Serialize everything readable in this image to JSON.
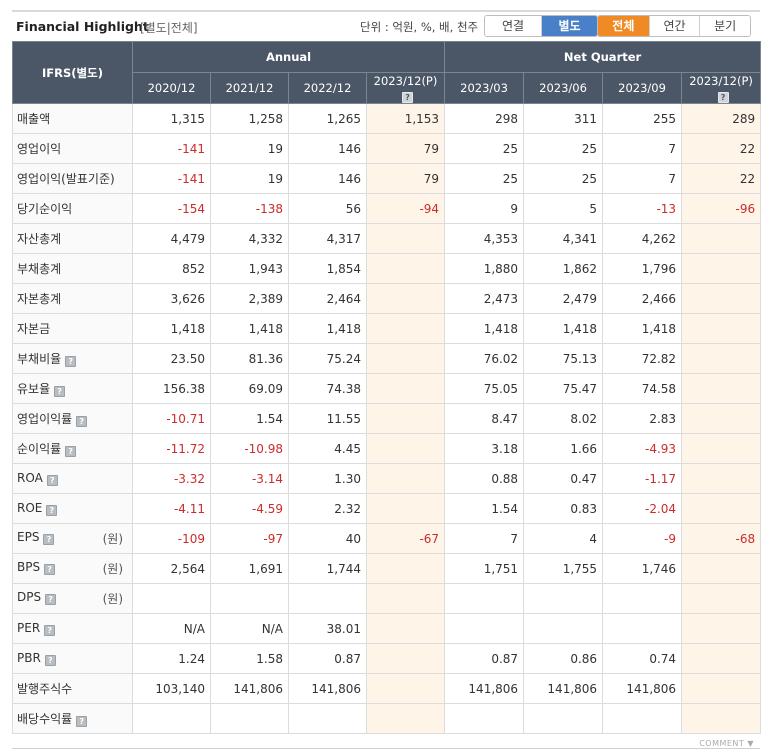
{
  "header": {
    "title": "Financial Highlight",
    "subtitle": "[별도|전체]",
    "unit_label": "단위 : 억원, %, 배, 천주",
    "toggle_basis": [
      "연결",
      "별도"
    ],
    "toggle_period": [
      "전체",
      "연간",
      "분기"
    ],
    "active_basis": "별도",
    "active_period": "전체"
  },
  "table": {
    "corner_label": "IFRS(별도)",
    "group_annual": "Annual",
    "group_quarter": "Net Quarter",
    "columns": [
      "2020/12",
      "2021/12",
      "2022/12",
      "2023/12(P)",
      "2023/03",
      "2023/06",
      "2023/09",
      "2023/12(P)"
    ],
    "rows": [
      {
        "label": "매출액",
        "unit": "",
        "help": false,
        "values": [
          "1,315",
          "1,258",
          "1,265",
          "1,153",
          "298",
          "311",
          "255",
          "289"
        ]
      },
      {
        "label": "영업이익",
        "unit": "",
        "help": false,
        "values": [
          "-141",
          "19",
          "146",
          "79",
          "25",
          "25",
          "7",
          "22"
        ]
      },
      {
        "label": "영업이익(발표기준)",
        "unit": "",
        "help": false,
        "values": [
          "-141",
          "19",
          "146",
          "79",
          "25",
          "25",
          "7",
          "22"
        ]
      },
      {
        "label": "당기순이익",
        "unit": "",
        "help": false,
        "values": [
          "-154",
          "-138",
          "56",
          "-94",
          "9",
          "5",
          "-13",
          "-96"
        ]
      },
      {
        "label": "자산총계",
        "unit": "",
        "help": false,
        "values": [
          "4,479",
          "4,332",
          "4,317",
          "",
          "4,353",
          "4,341",
          "4,262",
          ""
        ]
      },
      {
        "label": "부채총계",
        "unit": "",
        "help": false,
        "values": [
          "852",
          "1,943",
          "1,854",
          "",
          "1,880",
          "1,862",
          "1,796",
          ""
        ]
      },
      {
        "label": "자본총계",
        "unit": "",
        "help": false,
        "values": [
          "3,626",
          "2,389",
          "2,464",
          "",
          "2,473",
          "2,479",
          "2,466",
          ""
        ]
      },
      {
        "label": "자본금",
        "unit": "",
        "help": false,
        "values": [
          "1,418",
          "1,418",
          "1,418",
          "",
          "1,418",
          "1,418",
          "1,418",
          ""
        ]
      },
      {
        "label": "부채비율",
        "unit": "",
        "help": true,
        "values": [
          "23.50",
          "81.36",
          "75.24",
          "",
          "76.02",
          "75.13",
          "72.82",
          ""
        ]
      },
      {
        "label": "유보율",
        "unit": "",
        "help": true,
        "values": [
          "156.38",
          "69.09",
          "74.38",
          "",
          "75.05",
          "75.47",
          "74.58",
          ""
        ]
      },
      {
        "label": "영업이익률",
        "unit": "",
        "help": true,
        "values": [
          "-10.71",
          "1.54",
          "11.55",
          "",
          "8.47",
          "8.02",
          "2.83",
          ""
        ]
      },
      {
        "label": "순이익률",
        "unit": "",
        "help": true,
        "values": [
          "-11.72",
          "-10.98",
          "4.45",
          "",
          "3.18",
          "1.66",
          "-4.93",
          ""
        ]
      },
      {
        "label": "ROA",
        "unit": "",
        "help": true,
        "values": [
          "-3.32",
          "-3.14",
          "1.30",
          "",
          "0.88",
          "0.47",
          "-1.17",
          ""
        ]
      },
      {
        "label": "ROE",
        "unit": "",
        "help": true,
        "values": [
          "-4.11",
          "-4.59",
          "2.32",
          "",
          "1.54",
          "0.83",
          "-2.04",
          ""
        ]
      },
      {
        "label": "EPS",
        "unit": "(원)",
        "help": true,
        "values": [
          "-109",
          "-97",
          "40",
          "-67",
          "7",
          "4",
          "-9",
          "-68"
        ]
      },
      {
        "label": "BPS",
        "unit": "(원)",
        "help": true,
        "values": [
          "2,564",
          "1,691",
          "1,744",
          "",
          "1,751",
          "1,755",
          "1,746",
          ""
        ]
      },
      {
        "label": "DPS",
        "unit": "(원)",
        "help": true,
        "values": [
          "",
          "",
          "",
          "",
          "",
          "",
          "",
          ""
        ]
      },
      {
        "label": "PER",
        "unit": "",
        "help": true,
        "values": [
          "N/A",
          "N/A",
          "38.01",
          "",
          "",
          "",
          "",
          ""
        ]
      },
      {
        "label": "PBR",
        "unit": "",
        "help": true,
        "values": [
          "1.24",
          "1.58",
          "0.87",
          "",
          "0.87",
          "0.86",
          "0.74",
          ""
        ]
      },
      {
        "label": "발행주식수",
        "unit": "",
        "help": false,
        "values": [
          "103,140",
          "141,806",
          "141,806",
          "",
          "141,806",
          "141,806",
          "141,806",
          ""
        ]
      },
      {
        "label": "배당수익률",
        "unit": "",
        "help": true,
        "values": [
          "",
          "",
          "",
          "",
          "",
          "",
          "",
          ""
        ]
      }
    ]
  },
  "footer": {
    "comment_label": "COMMENT ▼"
  },
  "colors": {
    "header_bg": "#4b5766",
    "negative": "#cc2c2c",
    "estimate_bg": "#fff4e8",
    "basis_active": "#4a80c8",
    "period_active": "#f08a24"
  }
}
